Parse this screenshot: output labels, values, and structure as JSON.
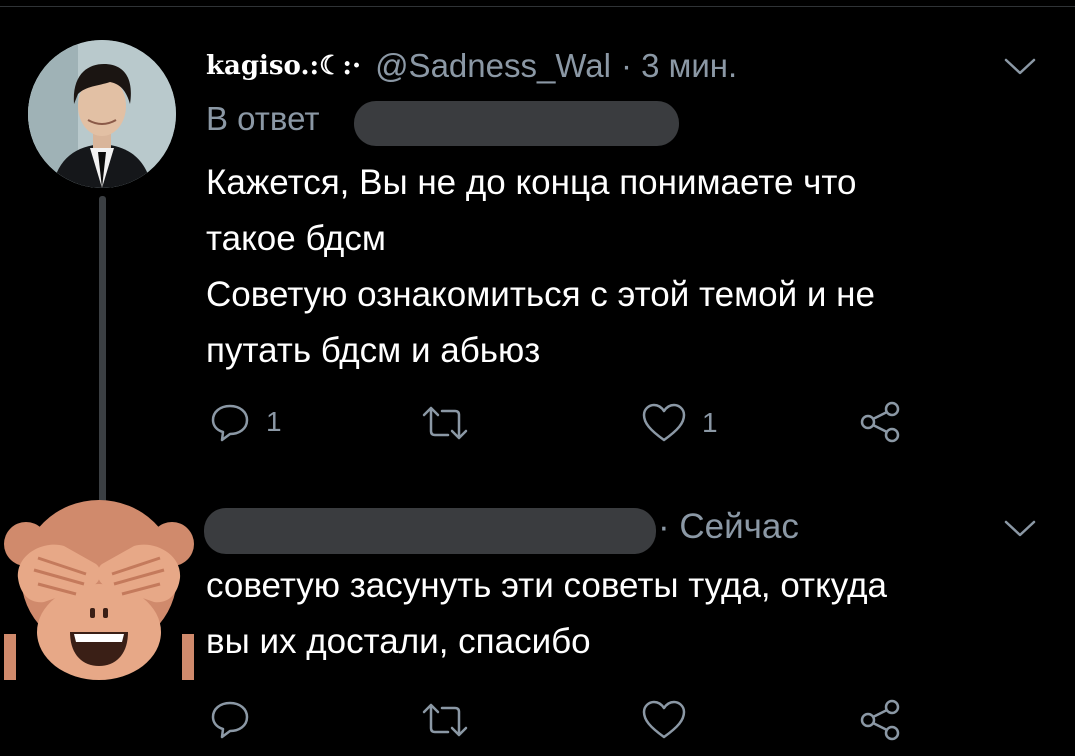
{
  "tweet1": {
    "display_name": "kagiso.:☾:·",
    "handle": "@Sadness_Wal",
    "time": "· 3 мин.",
    "reply_prefix": "В ответ",
    "text_lines": [
      "Кажется, Вы не до конца понимаете что",
      "такое бдсм",
      "Советую ознакомиться с этой темой и не",
      "путать бдсм и абьюз"
    ],
    "replies": "1",
    "likes": "1"
  },
  "tweet2": {
    "time": "· Сейчас",
    "text_lines": [
      "советую засунуть эти советы туда, откуда",
      "вы их достали, спасибо"
    ]
  },
  "icons": [
    "reply-icon",
    "retweet-icon",
    "like-icon",
    "share-icon",
    "chevron-down-icon"
  ],
  "colors": {
    "background": "#000000",
    "muted": "#8b98a5",
    "redaction": "#3a3c3f",
    "monkey": "#d08a6c"
  }
}
